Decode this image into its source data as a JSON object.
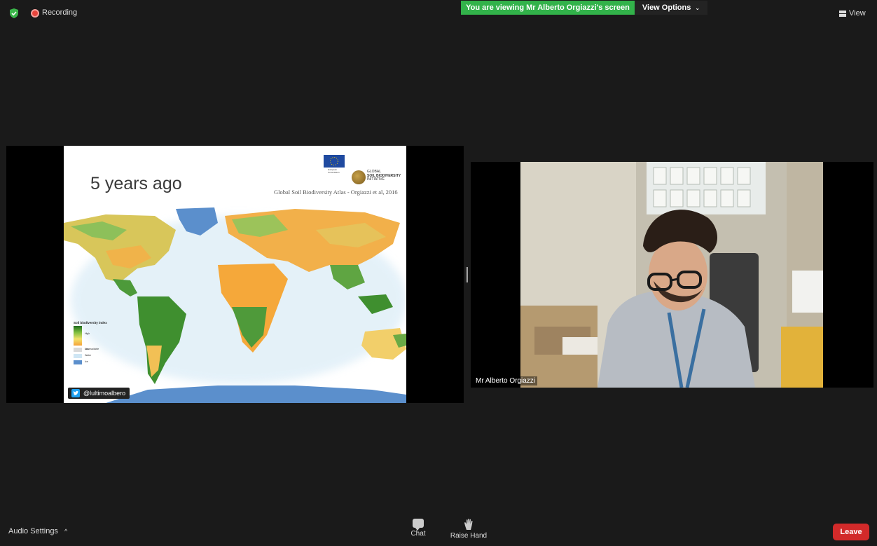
{
  "topbar": {
    "recording_label": "Recording",
    "viewing_banner": "You are viewing Mr Alberto Orgiazzi's screen",
    "view_options_label": "View Options",
    "view_label": "View"
  },
  "shared_screen": {
    "slide": {
      "title": "5 years ago",
      "subtitle": "Global Soil Biodiversity Atlas - Orgiazzi et al, 2016",
      "eu_logo_text": "European Commission",
      "gsbi_logo_line1": "GLOBAL",
      "gsbi_logo_line2": "SOIL BIODIVERSITY",
      "gsbi_logo_line3": "INITIATIVE",
      "legend": {
        "title": "Soil biodiversity index",
        "high": "High",
        "low": "Low",
        "not_available": "Not available",
        "water": "Water",
        "ice": "Ice"
      },
      "twitter_handle": "@lultimoalbero"
    }
  },
  "video": {
    "participant_name": "Mr Alberto Orgiazzi"
  },
  "toolbar": {
    "audio_settings_label": "Audio Settings",
    "chat_label": "Chat",
    "raise_hand_label": "Raise Hand",
    "leave_label": "Leave"
  },
  "colors": {
    "banner_green": "#32b24a",
    "leave_red": "#d22a2a",
    "background": "#1a1a1a"
  }
}
